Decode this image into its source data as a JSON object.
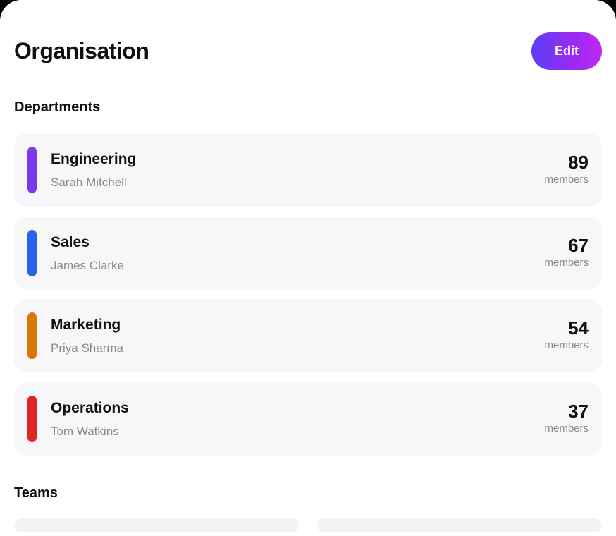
{
  "header": {
    "title": "Organisation",
    "edit_label": "Edit"
  },
  "sections": {
    "departments": "Departments",
    "teams": "Teams"
  },
  "departments": [
    {
      "name": "Engineering",
      "lead": "Sarah Mitchell",
      "count": "89",
      "count_label": "members",
      "color": "#7c3aed"
    },
    {
      "name": "Sales",
      "lead": "James Clarke",
      "count": "67",
      "count_label": "members",
      "color": "#2563eb"
    },
    {
      "name": "Marketing",
      "lead": "Priya Sharma",
      "count": "54",
      "count_label": "members",
      "color": "#d97706"
    },
    {
      "name": "Operations",
      "lead": "Tom Watkins",
      "count": "37",
      "count_label": "members",
      "color": "#dc2626"
    }
  ]
}
